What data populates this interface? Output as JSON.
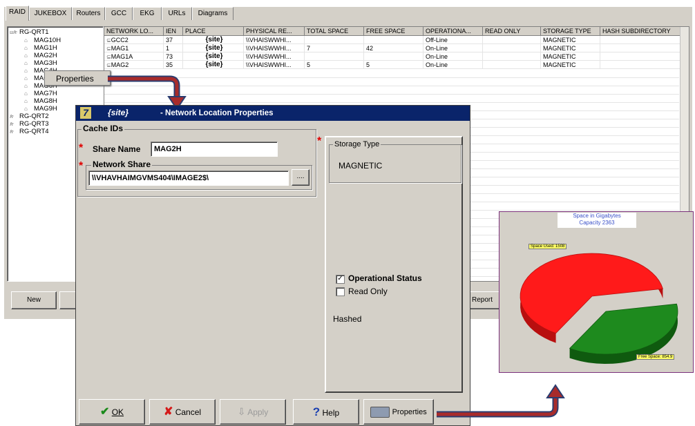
{
  "tabs": [
    "RAID",
    "JUKEBOX",
    "Routers",
    "GCC",
    "EKG",
    "URLs",
    "Diagrams"
  ],
  "tree": {
    "root": "RG-QRT1",
    "children": [
      "MAG10H",
      "MAG1H",
      "MAG2H",
      "MAG3H",
      "MAG4H",
      "MAG5H",
      "MAG6H",
      "MAG7H",
      "MAG8H",
      "MAG9H"
    ],
    "siblings": [
      "RG-QRT2",
      "RG-QRT3",
      "RG-QRT4"
    ]
  },
  "context_menu": {
    "item": "Properties"
  },
  "grid": {
    "headers": [
      "NETWORK LO...",
      "IEN",
      "PLACE",
      "PHYSICAL RE...",
      "TOTAL SPACE",
      "FREE SPACE",
      "OPERATIONA...",
      "READ ONLY",
      "STORAGE TYPE",
      "HASH SUBDIRECTORY"
    ],
    "rows": [
      [
        "GCC2",
        "37",
        "{site}",
        "\\\\VHAISWWHI...",
        "",
        "",
        "Off-Line",
        "",
        "MAGNETIC",
        ""
      ],
      [
        "MAG1",
        "1",
        "{site}",
        "\\\\VHAISWWHI...",
        "7",
        "42",
        "On-Line",
        "",
        "MAGNETIC",
        ""
      ],
      [
        "MAG1A",
        "73",
        "{site}",
        "\\\\VHAISWWHI...",
        "",
        "",
        "On-Line",
        "",
        "MAGNETIC",
        ""
      ],
      [
        "MAG2",
        "35",
        "{site}",
        "\\\\VHAISWWHI...",
        "5",
        "5",
        "On-Line",
        "",
        "MAGNETIC",
        ""
      ]
    ]
  },
  "main_buttons": {
    "new": "New",
    "report": "Report"
  },
  "dialog": {
    "logo": "7",
    "site": "{site}",
    "title": "- Network Location Properties",
    "cache_group": "Cache IDs",
    "share_name_label": "Share Name",
    "share_name_value": "MAG2H",
    "network_share_label": "Network Share",
    "network_share_value": "\\\\VHAVHAIMGVMS404\\IMAGE2$\\",
    "browse_label": "....",
    "storage_type_label": "Storage Type",
    "storage_type_value": "MAGNETIC",
    "operational_status_label": "Operational Status",
    "operational_status_checked": true,
    "read_only_label": "Read Only",
    "read_only_checked": false,
    "hashed_label": "Hashed",
    "ok_label": "OK",
    "cancel_label": "Cancel",
    "apply_label": "Apply",
    "help_label": "Help",
    "properties_label": "Properties"
  },
  "colors": {
    "used": "#ff1a1a",
    "free": "#1e8a1e",
    "titlebar": "#0a246a",
    "arrow": "#a82b2b",
    "arrow_outline": "#2b3d70"
  },
  "chart_data": {
    "type": "pie",
    "title": "Space in Gigabytes",
    "subtitle": "Capacity 2363",
    "slices": [
      {
        "label": "Space Used: 1508",
        "value": 1508
      },
      {
        "label": "Free Space: 854.9",
        "value": 854.9
      }
    ]
  }
}
